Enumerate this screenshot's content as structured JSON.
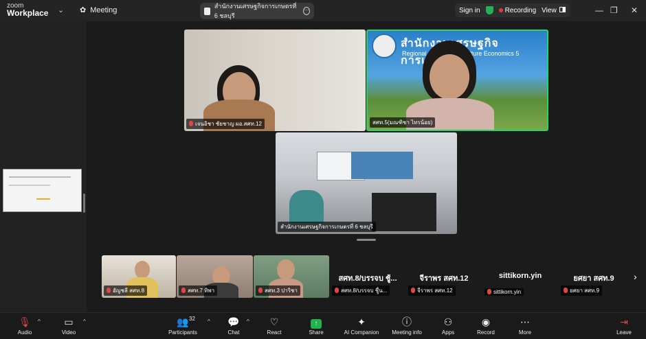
{
  "titlebar": {
    "brand_top": "zoom",
    "brand_bottom": "Workplace",
    "meeting_label": "Meeting",
    "doc_tab_title": "สำนักงานเศรษฐกิจการเกษตรที่ 6 ชลบุรี",
    "sign_in": "Sign in",
    "recording_label": "Recording",
    "view_label": "View"
  },
  "video_tiles": [
    {
      "label": "เจนอิชา ชัยชาญ ผอ.สศท.12"
    },
    {
      "label": "สศท.5(มณฑิชา ไทรน้อย)",
      "banner_title": "สำนักงานเศรษฐกิจการเกษตรที่ 5",
      "banner_sub": "Regional Office of Agriculture Economics 5"
    },
    {
      "label": "สำนักงานเศรษฐกิจการเกษตรที่ 6 ชลบุรี"
    }
  ],
  "strip_video": [
    {
      "label": "อัญชลี สศท.8"
    },
    {
      "label": "สศท.7 ทิพา"
    },
    {
      "label": "สศท.3 ปาริชา"
    }
  ],
  "strip_names": [
    {
      "name": "สศท.8/บรรจบ ชู้...",
      "label": "สศท.8/บรรจบ ชูื่น..."
    },
    {
      "name": "จีราพร สศท.12",
      "label": "จีราพร สศท.12"
    },
    {
      "name": "sittikorn.yin",
      "label": "sittikorn.yin"
    },
    {
      "name": "ยศยา สศท.9",
      "label": "ยศยา สศท.9"
    }
  ],
  "toolbar": {
    "audio": "Audio",
    "video": "Video",
    "participants": "Participants",
    "participants_count": "32",
    "chat": "Chat",
    "react": "React",
    "share": "Share",
    "ai_companion": "AI Companion",
    "meeting_info": "Meeting info",
    "apps": "Apps",
    "record": "Record",
    "more": "More",
    "leave": "Leave"
  },
  "colors": {
    "active_speaker_border": "#2bd36b",
    "share_green": "#22b24c",
    "mute_red": "#e04646"
  }
}
